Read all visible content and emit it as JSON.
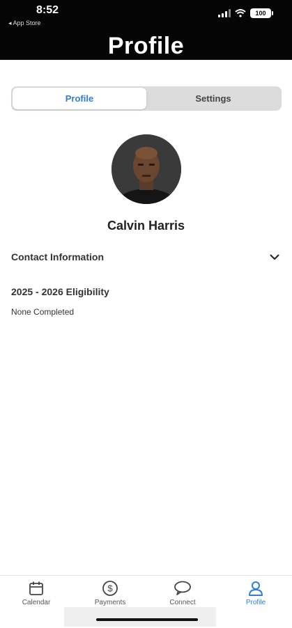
{
  "status_bar": {
    "time": "8:52",
    "back_app": "◂ App Store",
    "battery": "100"
  },
  "header": {
    "title": "Profile"
  },
  "segments": [
    {
      "label": "Profile",
      "active": true
    },
    {
      "label": "Settings",
      "active": false
    }
  ],
  "profile": {
    "name": "Calvin Harris"
  },
  "sections": {
    "contact_label": "Contact Information",
    "eligibility_title": "2025 - 2026 Eligibility",
    "eligibility_status": "None Completed"
  },
  "tabbar": {
    "items": [
      {
        "label": "Calendar",
        "icon": "calendar-icon"
      },
      {
        "label": "Payments",
        "icon": "dollar-icon"
      },
      {
        "label": "Connect",
        "icon": "chat-bubble-icon"
      },
      {
        "label": "Profile",
        "icon": "person-icon"
      }
    ]
  },
  "colors": {
    "accent": "#2d7fd3",
    "header_bg": "#050505"
  }
}
